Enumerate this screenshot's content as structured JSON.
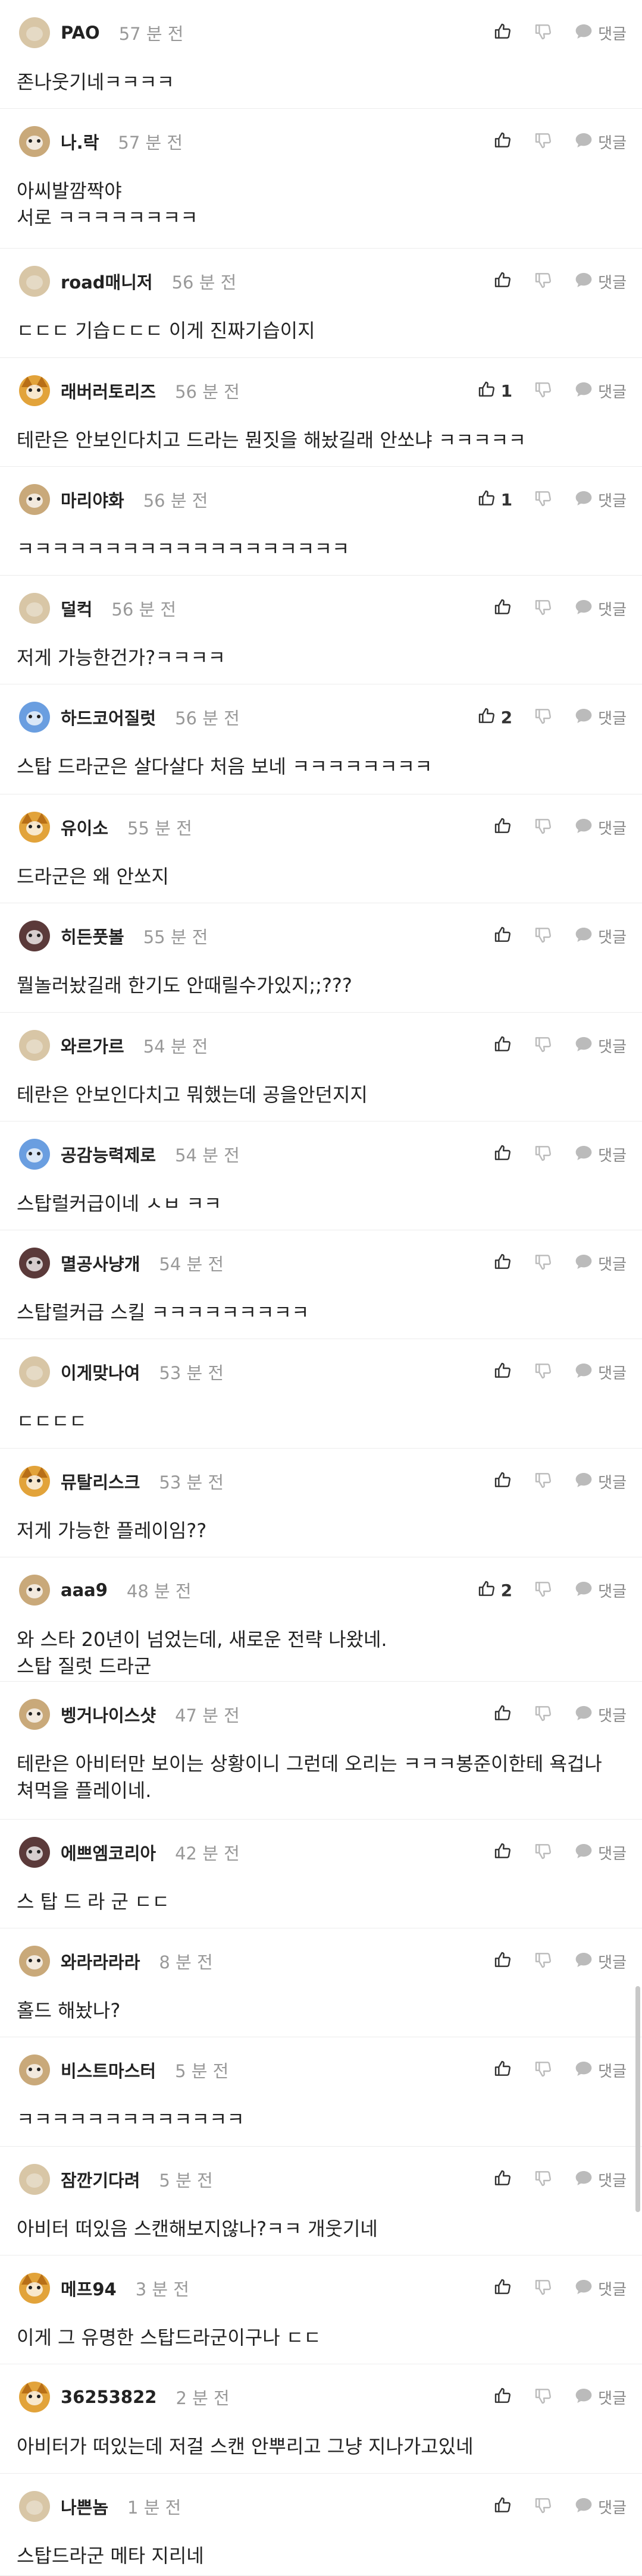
{
  "labels": {
    "reply": "댓글"
  },
  "comments": [
    {
      "avatar": "beige-blob",
      "author": "PAO",
      "time": "57 분 전",
      "likes": "",
      "text": "존나웃기네ㅋㅋㅋㅋ"
    },
    {
      "avatar": "puppy",
      "author": "나.락",
      "time": "57 분 전",
      "likes": "",
      "text": "아씨발깜짝야\n서로 ㅋㅋㅋㅋㅋㅋㅋㅋ"
    },
    {
      "avatar": "beige-blob",
      "author": "road매니저",
      "time": "56 분 전",
      "likes": "",
      "text": "ㄷㄷㄷ 기습ㄷㄷㄷ 이게 진짜기습이지"
    },
    {
      "avatar": "fox",
      "author": "래버러토리즈",
      "time": "56 분 전",
      "likes": "1",
      "text": "테란은 안보인다치고 드라는 뭔짓을 해놨길래 안쏘냐 ㅋㅋㅋㅋㅋ"
    },
    {
      "avatar": "puppy",
      "author": "마리야화",
      "time": "56 분 전",
      "likes": "1",
      "text": "ㅋㅋㅋㅋㅋㅋㅋㅋㅋㅋㅋㅋㅋㅋㅋㅋㅋㅋㅋ"
    },
    {
      "avatar": "beige-blob",
      "author": "덜컥",
      "time": "56 분 전",
      "likes": "",
      "text": "저게 가능한건가?ㅋㅋㅋㅋ"
    },
    {
      "avatar": "blue-creature",
      "author": "하드코어질럿",
      "time": "56 분 전",
      "likes": "2",
      "text": "스탑 드라군은 살다살다 처음 보네 ㅋㅋㅋㅋㅋㅋㅋㅋ"
    },
    {
      "avatar": "fox",
      "author": "유이소",
      "time": "55 분 전",
      "likes": "",
      "text": "드라군은 왜 안쏘지"
    },
    {
      "avatar": "dark-creature",
      "author": "히든풋볼",
      "time": "55 분 전",
      "likes": "",
      "text": "뭘놀러놨길래 한기도 안때릴수가있지;;???"
    },
    {
      "avatar": "beige-blob",
      "author": "와르가르",
      "time": "54 분 전",
      "likes": "",
      "text": "테란은 안보인다치고 뭐했는데 공을안던지지"
    },
    {
      "avatar": "blue-creature",
      "author": "공감능력제로",
      "time": "54 분 전",
      "likes": "",
      "text": "스탑럴커급이네 ㅅㅂ ㅋㅋ"
    },
    {
      "avatar": "dark-creature",
      "author": "멸공사냥개",
      "time": "54 분 전",
      "likes": "",
      "text": "스탑럴커급 스킬 ㅋㅋㅋㅋㅋㅋㅋㅋㅋ"
    },
    {
      "avatar": "beige-blob",
      "author": "이게맞나여",
      "time": "53 분 전",
      "likes": "",
      "text": "ㄷㄷㄷㄷ"
    },
    {
      "avatar": "fox",
      "author": "뮤탈리스크",
      "time": "53 분 전",
      "likes": "",
      "text": "저게 가능한 플레이임??"
    },
    {
      "avatar": "puppy",
      "author": "aaa9",
      "time": "48 분 전",
      "likes": "2",
      "text": "와 스타 20년이 넘었는데, 새로운 전략 나왔네.\n스탑 질럿 드라군"
    },
    {
      "avatar": "puppy",
      "author": "벵거나이스샷",
      "time": "47 분 전",
      "likes": "",
      "text": "테란은 아비터만 보이는 상황이니 그런데 오리는 ㅋㅋㅋ봉준이한테 욕겁나 쳐먹을 플레이네."
    },
    {
      "avatar": "dark-creature",
      "author": "에쁘엠코리아",
      "time": "42 분 전",
      "likes": "",
      "text": "스 탑 드 라 군 ㄷㄷ"
    },
    {
      "avatar": "puppy",
      "author": "와라라라라",
      "time": "8 분 전",
      "likes": "",
      "text": "홀드 해놨나?"
    },
    {
      "avatar": "puppy",
      "author": "비스트마스터",
      "time": "5 분 전",
      "likes": "",
      "text": "ㅋㅋㅋㅋㅋㅋㅋㅋㅋㅋㅋㅋㅋ"
    },
    {
      "avatar": "beige-blob",
      "author": "잠깐기다려",
      "time": "5 분 전",
      "likes": "",
      "text": "아비터 떠있음 스캔해보지않나?ㅋㅋ 개웃기네"
    },
    {
      "avatar": "fox",
      "author": "메프94",
      "time": "3 분 전",
      "likes": "",
      "text": "이게 그 유명한 스탑드라군이구나 ㄷㄷ"
    },
    {
      "avatar": "fox",
      "author": "36253822",
      "time": "2 분 전",
      "likes": "",
      "text": "아비터가 떠있는데 저걸 스캔 안뿌리고 그냥 지나가고있네"
    },
    {
      "avatar": "beige-blob",
      "author": "나쁜놈",
      "time": "1 분 전",
      "likes": "",
      "text": "스탑드라군 메타 지리네"
    }
  ]
}
